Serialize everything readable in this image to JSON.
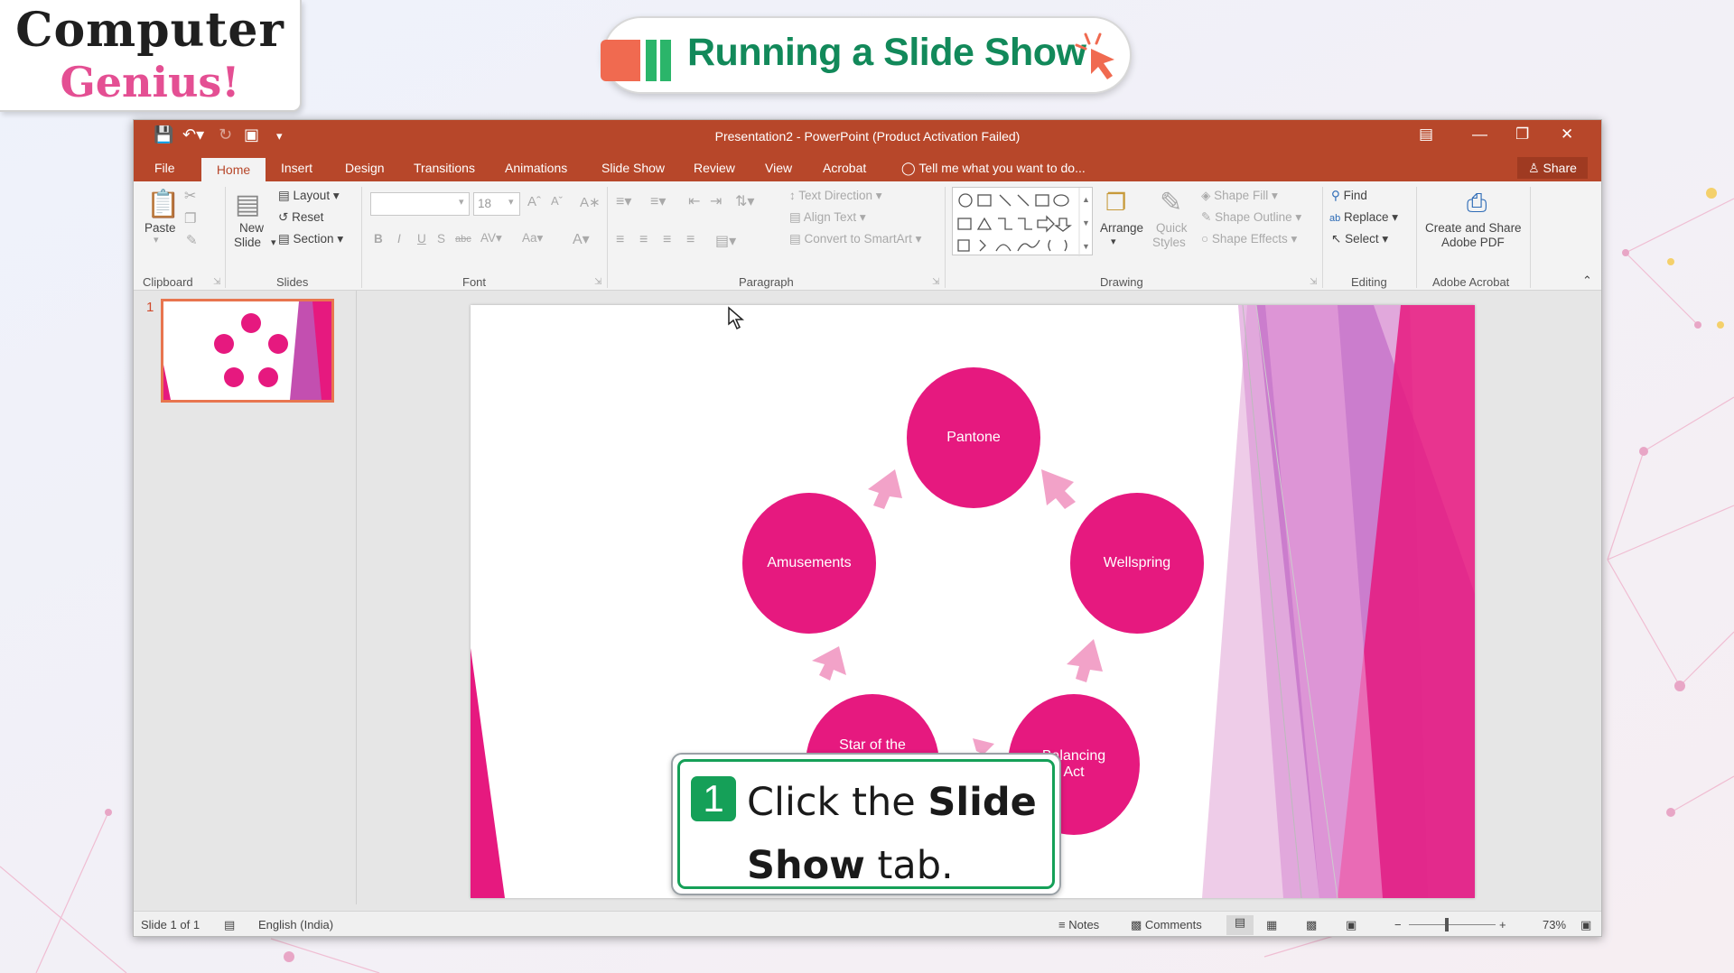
{
  "logo": {
    "line1": "Computer",
    "line2": "Genius!"
  },
  "banner": {
    "title": "Running a Slide Show"
  },
  "window": {
    "title": "Presentation2 - PowerPoint (Product Activation Failed)"
  },
  "menu_tabs": [
    "File",
    "Home",
    "Insert",
    "Design",
    "Transitions",
    "Animations",
    "Slide Show",
    "Review",
    "View",
    "Acrobat"
  ],
  "tell_me": "Tell me what you want to do...",
  "share": "Share",
  "ribbon": {
    "clipboard": {
      "label": "Clipboard",
      "paste": "Paste"
    },
    "slides": {
      "label": "Slides",
      "new_slide_1": "New",
      "new_slide_2": "Slide",
      "layout": "Layout",
      "reset": "Reset",
      "section": "Section"
    },
    "font": {
      "label": "Font",
      "size": "18"
    },
    "paragraph": {
      "label": "Paragraph",
      "text_direction": "Text Direction",
      "align_text": "Align Text",
      "convert_smartart": "Convert to SmartArt"
    },
    "drawing": {
      "label": "Drawing",
      "arrange": "Arrange",
      "quick_styles_1": "Quick",
      "quick_styles_2": "Styles",
      "shape_fill": "Shape Fill",
      "shape_outline": "Shape Outline",
      "shape_effects": "Shape Effects"
    },
    "editing": {
      "label": "Editing",
      "find": "Find",
      "replace": "Replace",
      "select": "Select"
    },
    "acrobat": {
      "label": "Adobe Acrobat",
      "create_1": "Create and Share",
      "create_2": "Adobe PDF"
    }
  },
  "thumbnail": {
    "number": "1"
  },
  "slide": {
    "nodes": [
      "Pantone",
      "Wellspring",
      "Balancing Act",
      "Star of the",
      "Amusements"
    ]
  },
  "status": {
    "slide": "Slide 1 of 1",
    "language": "English (India)",
    "notes": "Notes",
    "comments": "Comments",
    "zoom": "73%"
  },
  "callout": {
    "step": "1",
    "text_pre": "Click the ",
    "text_bold": "Slide Show",
    "text_post": " tab."
  },
  "colors": {
    "accent": "#b7472a",
    "slide_pink": "#e6197f",
    "title_green": "#12895a",
    "step_green": "#15a058"
  }
}
